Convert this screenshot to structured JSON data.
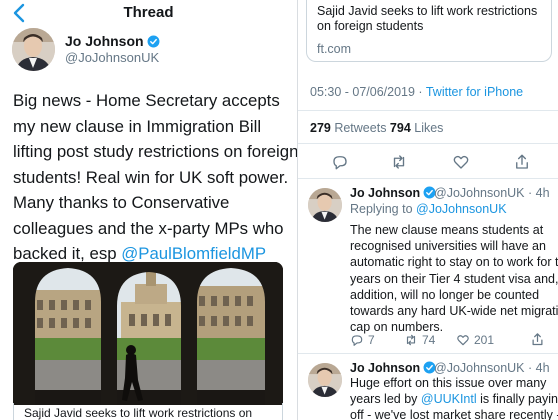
{
  "header": {
    "title": "Thread"
  },
  "main_tweet": {
    "author_name": "Jo Johnson",
    "author_handle": "@JoJohnsonUK",
    "text_lines": [
      "Big news - Home Secretary accepts",
      "my new clause in Immigration Bill",
      "lifting post study restrictions on foreign",
      "students! Real win for UK soft power.",
      "Many thanks to Conservative",
      "colleagues and the x-party MPs who",
      "backed it, esp "
    ],
    "mention": "@PaulBlomfieldMP",
    "media_caption": "Sajid Javid seeks to lift work restrictions on"
  },
  "link_card": {
    "title": "Sajid Javid seeks to lift work restrictions on foreign students",
    "domain": "ft.com"
  },
  "tweet_meta": {
    "time": "05:30 - 07/06/2019 · ",
    "source": "Twitter for iPhone"
  },
  "stats": {
    "retweets": "279",
    "retweets_label": " Retweets ",
    "likes": "794",
    "likes_label": " Likes"
  },
  "replies": [
    {
      "author_name": "Jo Johnson",
      "meta": "@JoJohnsonUK · 4h",
      "replying_prefix": "Replying to ",
      "replying_to": "@JoJohnsonUK",
      "text_lines": [
        "The new clause means students at",
        "recognised universities will have an",
        "automatic right to stay on to work for two",
        "years on their Tier 4 student visa and, in",
        "addition, will no longer be counted",
        "towards any hard UK-wide net migration",
        "cap on numbers."
      ],
      "reply_count": "7",
      "retweet_count": "74",
      "like_count": "201"
    },
    {
      "author_name": "Jo Johnson",
      "meta": "@JoJohnsonUK · 4h",
      "text_before": "Huge effort on this issue over many",
      "text_line2_prefix": "years led by ",
      "text_mention": "@UUKIntl",
      "text_line2_suffix": " is finally paying",
      "text_line3": "off - we've lost market share recently -"
    }
  ],
  "colors": {
    "accent": "#1b95e0",
    "secondary_text": "#657786",
    "divider": "#e1e8ed",
    "verified": "#1da1f2"
  }
}
